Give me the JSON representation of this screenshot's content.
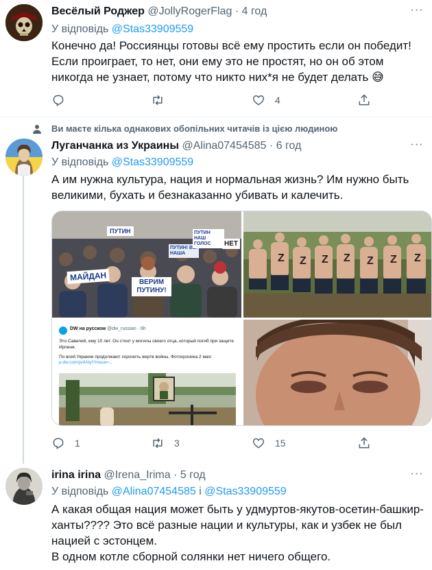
{
  "tweets": [
    {
      "name": "Весёлый Роджер",
      "handle": "@JollyRogerFlag",
      "dot": "·",
      "time": "4 год",
      "reply_prefix": "У відповідь",
      "reply_to": "@Stas33909559",
      "text": "Конечно да! Россиянцы готовы всё ему простить если он победит! Если проиграет, то нет, они ему это не простят, но он об этом никогда не узнает, потому что никто них*я не будет делать 😅",
      "retweets": "",
      "likes": "4"
    },
    {
      "social_context": "Ви маєте кілька однакових обопільних читачів із цією людиною",
      "name": "Луганчанка из Украины",
      "handle": "@Alina07454585",
      "dot": "·",
      "time": "6 год",
      "reply_prefix": "У відповідь",
      "reply_to": "@Stas33909559",
      "text": "А им нужна культура, нация и нормальная жизнь? Им нужно быть великими, бухать и безнаказанно убивать и калечить.",
      "replies": "1",
      "retweets": "3",
      "likes": "15",
      "media": {
        "photo1_signs": [
          "ПУТИН",
          "МАЙДАН",
          "ВЕРИМ ПУТИНУ!",
          "НЕТ",
          "ПУТИН! ВЫ НАША",
          "ПУТИН НАШ ГОЛОС"
        ],
        "photo2_letters": [
          "Z",
          "Z",
          "Z",
          "Z",
          "Z",
          "Z",
          "Z"
        ],
        "photo3_brand": "DW на русском",
        "photo3_handle": "@dw_russian · 6h",
        "photo3_text": "Это Савелий, ему 10 лет. Он стоит у могилы своего отца, который погиб при защите Ирпеня.",
        "photo3_text2": "По всей Украине продолжают хоронить жертв войны. Фотохроника 2 мая:",
        "photo3_link": "p.dw.com/p/4AlyI?maca=..."
      }
    },
    {
      "name": "irina irina",
      "handle": "@Irena_Irima",
      "dot": "·",
      "time": "5 год",
      "reply_prefix": "У відповідь",
      "reply_to": "@Alina07454585",
      "reply_and": "і",
      "reply_to2": "@Stas33909559",
      "text_lines": [
        "А какая общая нация может быть у удмуртов-якутов-осетин-башкир-ханты???? Это всё разные нации и культуры, как и узбек не был нацией с эстонцем.",
        "В одном котле сборной солянки нет ничего общего."
      ]
    }
  ],
  "colors": {
    "accent": "#1d9bf0",
    "secondary": "#536471",
    "text": "#0f1419",
    "divider": "#eff3f4"
  },
  "icons": [
    "reply-icon",
    "retweet-icon",
    "like-icon",
    "share-icon",
    "more-icon",
    "person-icon"
  ]
}
